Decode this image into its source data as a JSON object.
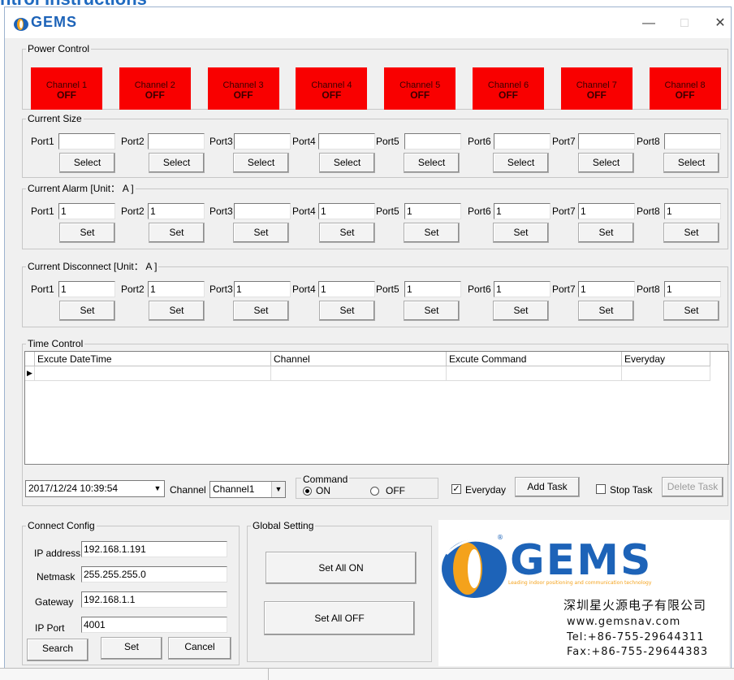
{
  "page_heading": "ntrol Instructions",
  "app": {
    "title": "GEMS",
    "min_icon": "minimize-icon",
    "max_icon": "maximize-icon",
    "close_icon": "close-icon"
  },
  "power": {
    "legend": "Power Control",
    "channels": [
      {
        "name": "Channel 1",
        "state": "OFF"
      },
      {
        "name": "Channel 2",
        "state": "OFF"
      },
      {
        "name": "Channel 3",
        "state": "OFF"
      },
      {
        "name": "Channel 4",
        "state": "OFF"
      },
      {
        "name": "Channel 5",
        "state": "OFF"
      },
      {
        "name": "Channel 6",
        "state": "OFF"
      },
      {
        "name": "Channel 7",
        "state": "OFF"
      },
      {
        "name": "Channel 8",
        "state": "OFF"
      }
    ],
    "off_color": "#f90000"
  },
  "current_size": {
    "legend": "Current Size",
    "ports": [
      "Port1",
      "Port2",
      "Port3",
      "Port4",
      "Port5",
      "Port6",
      "Port7",
      "Port8"
    ],
    "values": [
      "",
      "",
      "",
      "",
      "",
      "",
      "",
      ""
    ],
    "button": "Select"
  },
  "current_alarm": {
    "legend": "Current Alarm [Unit： A ]",
    "ports": [
      "Port1",
      "Port2",
      "Port3",
      "Port4",
      "Port5",
      "Port6",
      "Port7",
      "Port8"
    ],
    "values": [
      "1",
      "1",
      "",
      "1",
      "1",
      "1",
      "1",
      "1"
    ],
    "button": "Set"
  },
  "current_disconnect": {
    "legend": "Current Disconnect  [Unit： A ]",
    "ports": [
      "Port1",
      "Port2",
      "Port3",
      "Port4",
      "Port5",
      "Port6",
      "Port7",
      "Port8"
    ],
    "values": [
      "1",
      "1",
      "1",
      "1",
      "1",
      "1",
      "1",
      "1"
    ],
    "button": "Set"
  },
  "time_control": {
    "legend": "Time Control",
    "columns": [
      "Excute DateTime",
      "Channel",
      "Excute Command",
      "Everyday"
    ],
    "datetime": "2017/12/24 10:39:54",
    "channel_label": "Channel",
    "channel_value": "Channel1",
    "command_legend": "Command",
    "on_label": "ON",
    "off_label": "OFF",
    "everyday_label": "Everyday",
    "everyday_checked": true,
    "add_task": "Add Task",
    "stop_task": "Stop Task",
    "delete_task": "Delete Task"
  },
  "connect": {
    "legend": "Connect Config",
    "ip_label": "IP address",
    "ip_value": "192.168.1.191",
    "netmask_label": "Netmask",
    "netmask_value": "255.255.255.0",
    "gateway_label": "Gateway",
    "gateway_value": "192.168.1.1",
    "port_label": "IP Port",
    "port_value": "4001",
    "search": "Search",
    "set": "Set",
    "cancel": "Cancel"
  },
  "global": {
    "legend": "Global Setting",
    "all_on": "Set  All  ON",
    "all_off": "Set  All  OFF"
  },
  "brand": {
    "logo_text": "GEMS",
    "tagline": "Leading indoor positioning and communication technology",
    "company": "深圳星火源电子有限公司",
    "website": "www.gemsnav.com",
    "tel": "Tel:+86-755-29644311",
    "fax": "Fax:+86-755-29644383",
    "blue": "#1d63b8",
    "gold": "#f4a21b"
  }
}
